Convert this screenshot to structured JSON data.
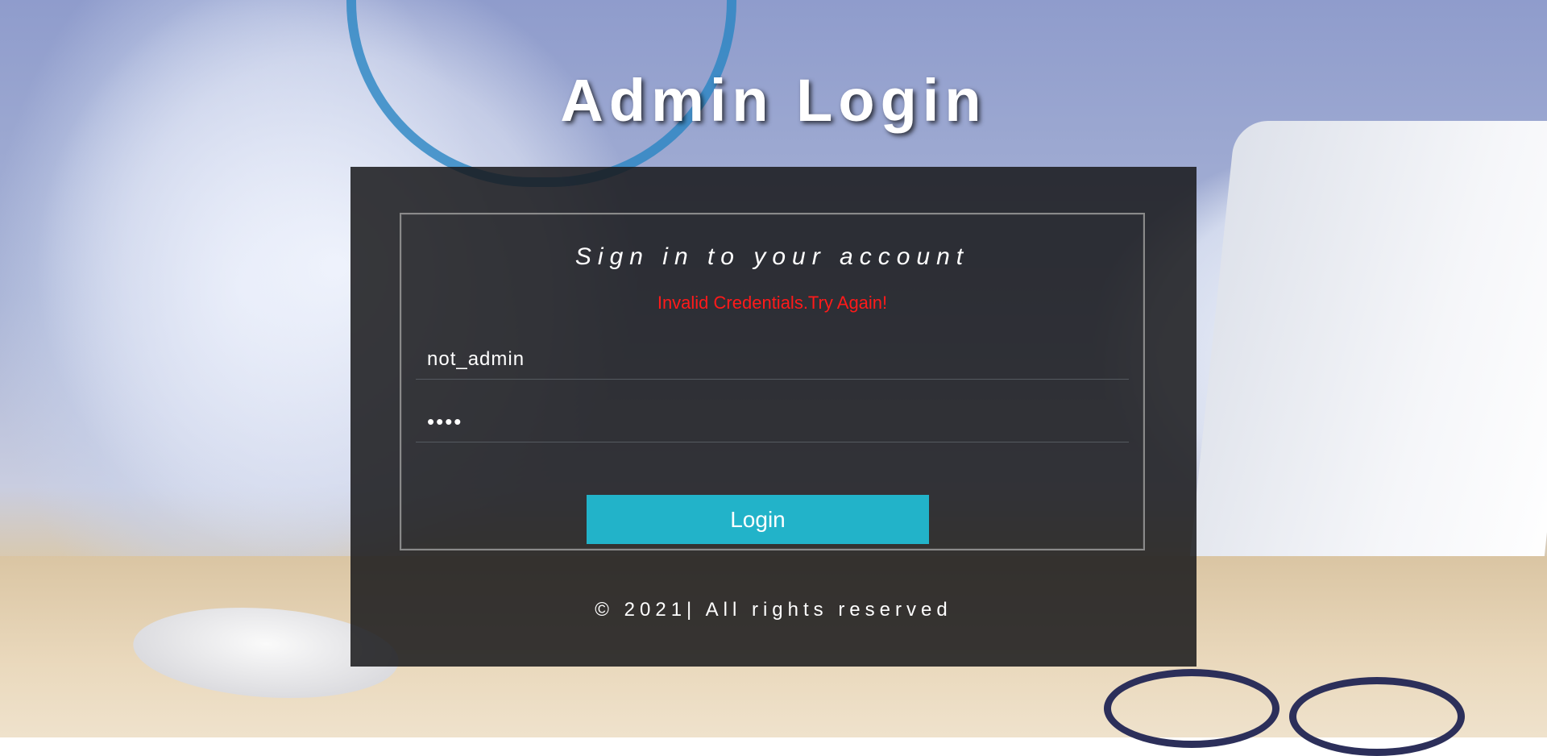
{
  "page": {
    "title": "Admin Login"
  },
  "form": {
    "subtitle": "Sign in to your account",
    "error": "Invalid Credentials.Try Again!",
    "username_value": "not_admin",
    "password_value": "....",
    "login_label": "Login"
  },
  "footer": {
    "text": "© 2021| All rights reserved"
  },
  "colors": {
    "panel_bg": "#19191b",
    "button": "#22b3c9",
    "error": "#ff1a1a"
  }
}
